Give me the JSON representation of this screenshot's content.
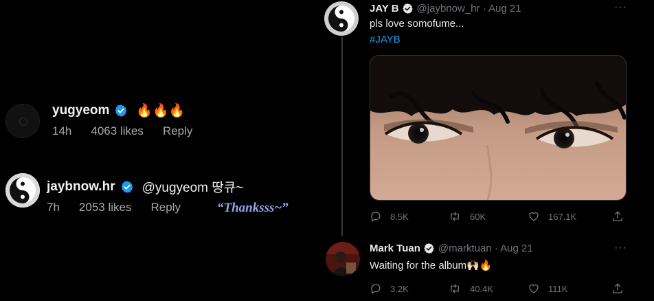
{
  "instagram": {
    "comments": [
      {
        "username": "yugyeom",
        "text": "🔥🔥🔥",
        "time": "14h",
        "likes": "4063 likes",
        "reply": "Reply"
      },
      {
        "username": "jaybnow.hr",
        "text": "@yugyeom 땅큐~",
        "time": "7h",
        "likes": "2053 likes",
        "reply": "Reply",
        "annotation": "“Thanksss~”"
      }
    ]
  },
  "twitter": {
    "tweets": [
      {
        "display_name": "JAY B",
        "handle_time": "@jaybnow_hr · Aug 21",
        "text": "pls love somofume...",
        "hashtag": "#JAYB",
        "replies": "8.5K",
        "retweets": "60K",
        "likes": "167.1K"
      },
      {
        "display_name": "Mark Tuan",
        "handle_time": "@marktuan · Aug 21",
        "text": "Waiting for the album🙌🏻🔥",
        "replies": "3.2K",
        "retweets": "40.4K",
        "likes": "111K"
      }
    ]
  },
  "colors": {
    "background": "#000000",
    "verified_blue": "#1d9bf0",
    "muted_text": "#71767b",
    "ig_muted_text": "#a8a8a8",
    "hashtag": "#1d9bf0",
    "annotation": "#8ea6e8"
  },
  "icons": [
    "verified-badge-icon",
    "more-icon",
    "reply-icon",
    "retweet-icon",
    "like-icon",
    "share-icon"
  ]
}
